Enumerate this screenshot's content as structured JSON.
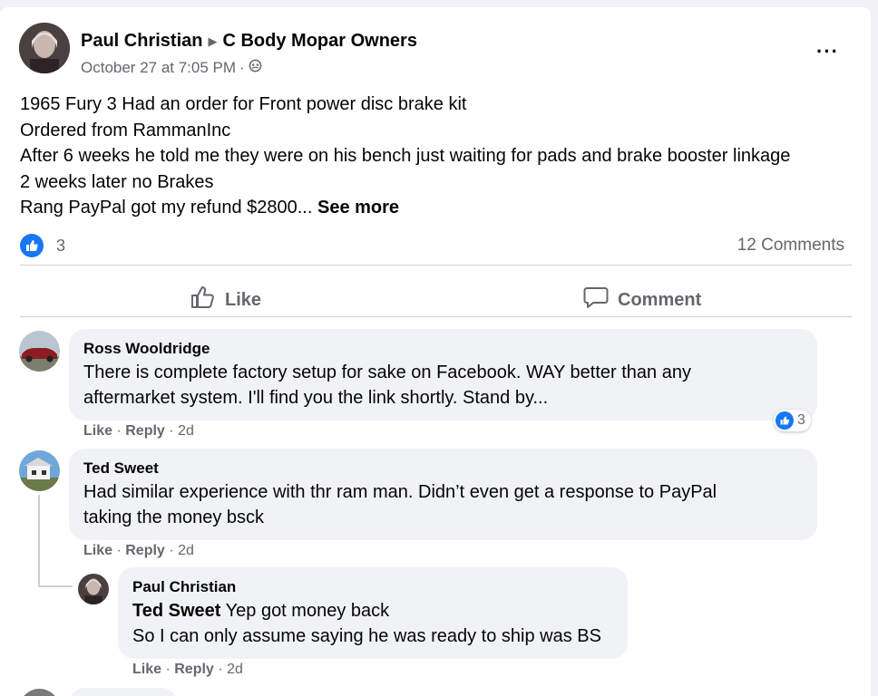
{
  "post": {
    "author": "Paul Christian",
    "group": "C Body Mopar Owners",
    "timestamp": "October 27 at 7:05 PM",
    "dot": "·",
    "lines": [
      "1965 Fury 3 Had an order for Front power disc brake kit",
      "Ordered from RammanInc",
      "After 6 weeks he told me they were on his bench just waiting for pads and brake booster linkage",
      "2 weeks later no Brakes",
      "Rang PayPal got my refund $2800..."
    ],
    "see_more": "See more",
    "reaction_count": "3",
    "comments_count": "12 Comments",
    "more_icon": "···"
  },
  "actions": {
    "like": "Like",
    "comment": "Comment"
  },
  "comments": [
    {
      "name": "Ross Wooldridge",
      "lines": [
        "There is complete factory setup for sake on Facebook. WAY better than any",
        "aftermarket system. I'll find you the link shortly. Stand by..."
      ],
      "like": "Like",
      "reply": "Reply",
      "sep": "·",
      "age": "2d",
      "reactions": "3"
    },
    {
      "name": "Ted Sweet",
      "lines": [
        "Had similar experience with thr ram man. Didn’t even get a response to PayPal",
        "taking the money bsck"
      ],
      "like": "Like",
      "reply": "Reply",
      "sep": "·",
      "age": "2d"
    },
    {
      "name": "Paul Christian",
      "mention": "Ted Sweet",
      "line1_rest": " Yep got money back",
      "line2": "So I can only assume saying he was ready to ship was BS",
      "like": "Like",
      "reply": "Reply",
      "sep": "·",
      "age": "2d"
    }
  ],
  "colors": {
    "accent": "#1877f2",
    "muted": "#65676b",
    "bubble": "#f0f2f5"
  }
}
